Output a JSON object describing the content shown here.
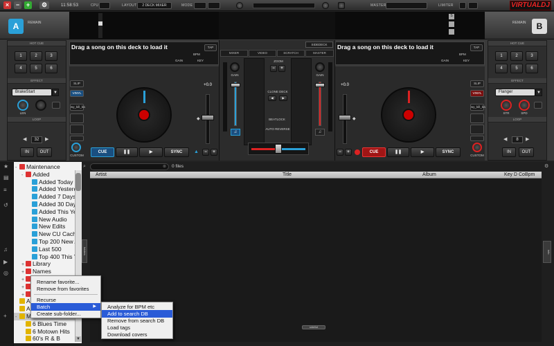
{
  "topbar": {
    "clock": "11:58:53",
    "cpu_label": "CPU",
    "layout_label": "LAYOUT",
    "layout_value": "2 DECK MIXER",
    "mode_label": "MODE",
    "master_label": "MASTER",
    "limiter_label": "LIMITER",
    "logo": "VIRTUALDJ"
  },
  "deck_a": {
    "letter": "A",
    "remain": "REMAIN",
    "hot_cue": "HOT CUE",
    "pads": [
      "1",
      "2",
      "3",
      "4",
      "5",
      "6"
    ],
    "effect_label": "EFFECT",
    "effect_value": "BrakeStart",
    "knob1": "LEN",
    "loop_label": "LOOP",
    "loop_value": "32",
    "in": "IN",
    "out": "OUT",
    "song": "Drag a song on this deck to load it",
    "tap": "TAP",
    "bpm": "BPM",
    "gain": "GAIN",
    "key": "KEY",
    "slip": "SLIP",
    "vinyl": "VINYL",
    "sampler": "wy_kill_ba",
    "custom": "CUSTOM",
    "cue": "CUE",
    "pause": "❚❚",
    "play": "▶",
    "sync": "SYNC",
    "pitch": "+0.0"
  },
  "deck_b": {
    "letter": "B",
    "remain": "REMAIN",
    "hot_cue": "HOT CUE",
    "pads": [
      "1",
      "2",
      "3",
      "4",
      "5",
      "6"
    ],
    "effect_label": "EFFECT",
    "effect_value": "Flanger",
    "knob1": "STR",
    "knob2": "SPD",
    "loop_label": "LOOP",
    "loop_value": "8",
    "in": "IN",
    "out": "OUT",
    "song": "Drag a song on this deck to load it",
    "tap": "TAP",
    "bpm": "BPM",
    "gain": "GAIN",
    "key": "KEY",
    "slip": "SLIP",
    "vinyl": "VINYL",
    "sampler": "wy_kill_ba",
    "custom": "CUSTOM",
    "cue": "CUE",
    "pause": "❚❚",
    "play": "▶",
    "sync": "SYNC",
    "pitch": "+0.0"
  },
  "mixer": {
    "sidedeck": "SIDEDECK",
    "tabs": [
      "MIXER",
      "VIDEO",
      "SCRATCH",
      "MASTER"
    ],
    "gain_left": "GAIN",
    "gain_right": "GAIN",
    "zoom": "ZOOM",
    "clone_deck": "CLONE DECK",
    "beatlock": "BEATLOCK",
    "auto_reverse": "AUTO REVERSE"
  },
  "browser": {
    "files_count": "0 files",
    "columns": [
      "Artist",
      "Title",
      "Album",
      "Key",
      "D",
      "Co",
      "Bpm"
    ],
    "sidelist_btn": "sidelist",
    "sideview_btn": "folders",
    "right_btn": "info",
    "tree": [
      {
        "label": "Maintenance",
        "indent": 0,
        "color": "#d33",
        "exp": "-"
      },
      {
        "label": "Added",
        "indent": 1,
        "color": "#d33",
        "exp": "-"
      },
      {
        "label": "Added Today",
        "indent": 2,
        "color": "#2aa0d8",
        "exp": ""
      },
      {
        "label": "Added Yesterday",
        "indent": 2,
        "color": "#2aa0d8",
        "exp": ""
      },
      {
        "label": "Added 7 Days",
        "indent": 2,
        "color": "#2aa0d8",
        "exp": ""
      },
      {
        "label": "Added 30 Days",
        "indent": 2,
        "color": "#2aa0d8",
        "exp": ""
      },
      {
        "label": "Added This Year",
        "indent": 2,
        "color": "#2aa0d8",
        "exp": ""
      },
      {
        "label": "New Audio",
        "indent": 2,
        "color": "#2aa0d8",
        "exp": ""
      },
      {
        "label": "New Edits",
        "indent": 2,
        "color": "#2aa0d8",
        "exp": ""
      },
      {
        "label": "New CU Cache",
        "indent": 2,
        "color": "#2aa0d8",
        "exp": ""
      },
      {
        "label": "Top 200 New Audio",
        "indent": 2,
        "color": "#2aa0d8",
        "exp": ""
      },
      {
        "label": "Last 500",
        "indent": 2,
        "color": "#2aa0d8",
        "exp": ""
      },
      {
        "label": "Top 400 This Year",
        "indent": 2,
        "color": "#2aa0d8",
        "exp": ""
      },
      {
        "label": "Library",
        "indent": 1,
        "color": "#d33",
        "exp": "+"
      },
      {
        "label": "Names",
        "indent": 1,
        "color": "#d33",
        "exp": "+"
      },
      {
        "label": "",
        "indent": 1,
        "color": "#d33",
        "exp": "+"
      },
      {
        "label": "",
        "indent": 1,
        "color": "#d33",
        "exp": "+"
      },
      {
        "label": "",
        "indent": 1,
        "color": "#d33",
        "exp": "+"
      },
      {
        "label": "A",
        "indent": 0,
        "color": "#e2b400",
        "exp": ""
      },
      {
        "label": "A",
        "indent": 0,
        "color": "#e2b400",
        "exp": ""
      },
      {
        "label": "M",
        "indent": 0,
        "color": "#e2b400",
        "exp": "-",
        "selected": true
      },
      {
        "label": "6 Blues Time",
        "indent": 1,
        "color": "#e2b400",
        "exp": ""
      },
      {
        "label": "6 Motown Hits",
        "indent": 1,
        "color": "#e2b400",
        "exp": ""
      },
      {
        "label": "60's R & B",
        "indent": 1,
        "color": "#e2b400",
        "exp": ""
      }
    ]
  },
  "context_menu": {
    "items": [
      "Rename favorite...",
      "Remove from favorites",
      "Recurse",
      "Batch",
      "Create sub-folder..."
    ],
    "batch_arrow": "▶"
  },
  "submenu": {
    "items": [
      "Analyze for BPM etc",
      "Add to search DB",
      "Remove from search DB",
      "Load tags",
      "Download covers"
    ]
  },
  "colors": {
    "deck_a_accent": "#2aa0d8",
    "deck_b_accent": "#d22",
    "menu_highlight": "#2a5bd7"
  }
}
